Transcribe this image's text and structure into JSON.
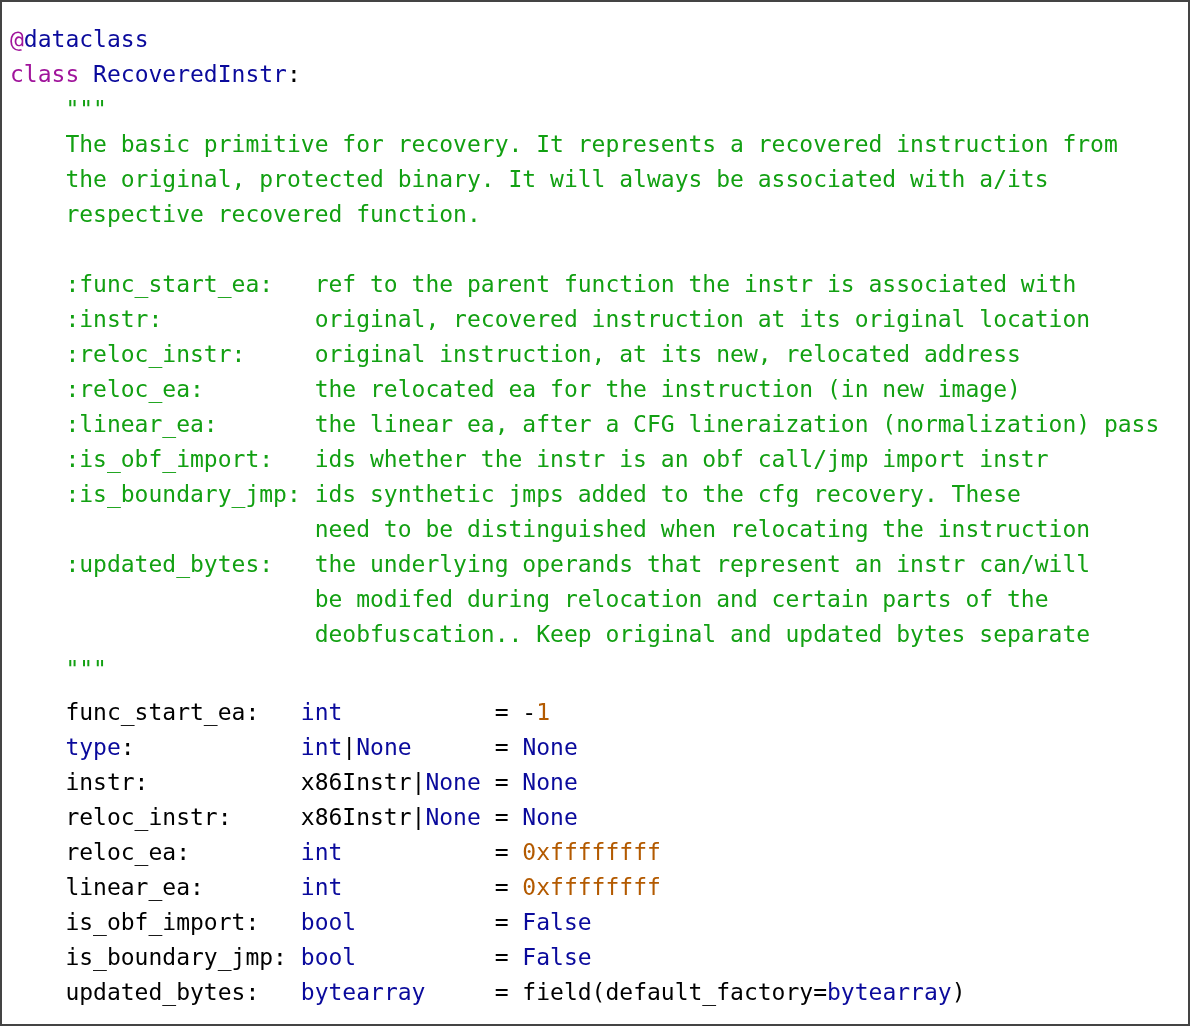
{
  "code": {
    "lines": [
      {
        "tokens": [
          {
            "kind": "keyword",
            "text": "@"
          },
          {
            "kind": "name",
            "text": "dataclass"
          }
        ]
      },
      {
        "tokens": [
          {
            "kind": "keyword",
            "text": "class"
          },
          {
            "kind": "name",
            "text": " RecoveredInstr"
          },
          {
            "kind": "plain",
            "text": ":"
          }
        ]
      },
      {
        "tokens": [
          {
            "kind": "string",
            "text": "    \"\"\""
          }
        ]
      },
      {
        "tokens": [
          {
            "kind": "string",
            "text": "    The basic primitive for recovery. It represents a recovered instruction from"
          }
        ]
      },
      {
        "tokens": [
          {
            "kind": "string",
            "text": "    the original, protected binary. It will always be associated with a/its"
          }
        ]
      },
      {
        "tokens": [
          {
            "kind": "string",
            "text": "    respective recovered function."
          }
        ]
      },
      {
        "gap_before": true,
        "tokens": [
          {
            "kind": "string",
            "text": "    :func_start_ea:   ref to the parent function the instr is associated with"
          }
        ]
      },
      {
        "tokens": [
          {
            "kind": "string",
            "text": "    :instr:           original, recovered instruction at its original location"
          }
        ]
      },
      {
        "tokens": [
          {
            "kind": "string",
            "text": "    :reloc_instr:     original instruction, at its new, relocated address"
          }
        ]
      },
      {
        "tokens": [
          {
            "kind": "string",
            "text": "    :reloc_ea:        the relocated ea for the instruction (in new image)"
          }
        ]
      },
      {
        "tokens": [
          {
            "kind": "string",
            "text": "    :linear_ea:       the linear ea, after a CFG lineraization (normalization) pass"
          }
        ]
      },
      {
        "tokens": [
          {
            "kind": "string",
            "text": "    :is_obf_import:   ids whether the instr is an obf call/jmp import instr"
          }
        ]
      },
      {
        "tokens": [
          {
            "kind": "string",
            "text": "    :is_boundary_jmp: ids synthetic jmps added to the cfg recovery. These"
          }
        ]
      },
      {
        "tokens": [
          {
            "kind": "string",
            "text": "                      need to be distinguished when relocating the instruction"
          }
        ]
      },
      {
        "tokens": [
          {
            "kind": "string",
            "text": "    :updated_bytes:   the underlying operands that represent an instr can/will"
          }
        ]
      },
      {
        "tokens": [
          {
            "kind": "string",
            "text": "                      be modifed during relocation and certain parts of the"
          }
        ]
      },
      {
        "tokens": [
          {
            "kind": "string",
            "text": "                      deobfuscation.. Keep original and updated bytes separate"
          }
        ]
      },
      {
        "tokens": [
          {
            "kind": "string",
            "text": "    \"\"\""
          }
        ]
      },
      {
        "gap_small": true,
        "tokens": [
          {
            "kind": "plain",
            "text": "    func_start_ea:   "
          },
          {
            "kind": "name",
            "text": "int"
          },
          {
            "kind": "plain",
            "text": "           = -"
          },
          {
            "kind": "number",
            "text": "1"
          }
        ]
      },
      {
        "tokens": [
          {
            "kind": "name",
            "text": "    type"
          },
          {
            "kind": "plain",
            "text": ":            "
          },
          {
            "kind": "name",
            "text": "int"
          },
          {
            "kind": "plain",
            "text": "|"
          },
          {
            "kind": "name",
            "text": "None"
          },
          {
            "kind": "plain",
            "text": "      = "
          },
          {
            "kind": "name",
            "text": "None"
          }
        ]
      },
      {
        "tokens": [
          {
            "kind": "plain",
            "text": "    instr:           x86Instr|"
          },
          {
            "kind": "name",
            "text": "None"
          },
          {
            "kind": "plain",
            "text": " = "
          },
          {
            "kind": "name",
            "text": "None"
          }
        ]
      },
      {
        "tokens": [
          {
            "kind": "plain",
            "text": "    reloc_instr:     x86Instr|"
          },
          {
            "kind": "name",
            "text": "None"
          },
          {
            "kind": "plain",
            "text": " = "
          },
          {
            "kind": "name",
            "text": "None"
          }
        ]
      },
      {
        "tokens": [
          {
            "kind": "plain",
            "text": "    reloc_ea:        "
          },
          {
            "kind": "name",
            "text": "int"
          },
          {
            "kind": "plain",
            "text": "           = "
          },
          {
            "kind": "number",
            "text": "0xffffffff"
          }
        ]
      },
      {
        "tokens": [
          {
            "kind": "plain",
            "text": "    linear_ea:       "
          },
          {
            "kind": "name",
            "text": "int"
          },
          {
            "kind": "plain",
            "text": "           = "
          },
          {
            "kind": "number",
            "text": "0xffffffff"
          }
        ]
      },
      {
        "tokens": [
          {
            "kind": "plain",
            "text": "    is_obf_import:   "
          },
          {
            "kind": "name",
            "text": "bool"
          },
          {
            "kind": "plain",
            "text": "          = "
          },
          {
            "kind": "name",
            "text": "False"
          }
        ]
      },
      {
        "tokens": [
          {
            "kind": "plain",
            "text": "    is_boundary_jmp: "
          },
          {
            "kind": "name",
            "text": "bool"
          },
          {
            "kind": "plain",
            "text": "          = "
          },
          {
            "kind": "name",
            "text": "False"
          }
        ]
      },
      {
        "tokens": [
          {
            "kind": "plain",
            "text": "    updated_bytes:   "
          },
          {
            "kind": "name",
            "text": "bytearray"
          },
          {
            "kind": "plain",
            "text": "     = field(default_factory="
          },
          {
            "kind": "name",
            "text": "bytearray"
          },
          {
            "kind": "plain",
            "text": ")"
          }
        ]
      }
    ]
  }
}
